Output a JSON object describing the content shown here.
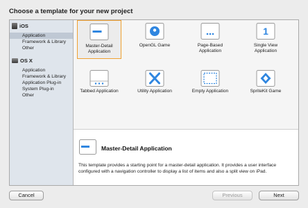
{
  "title": "Choose a template for your new project",
  "sidebar": {
    "ios_header": "iOS",
    "ios_items": [
      "Application",
      "Framework & Library",
      "Other"
    ],
    "osx_header": "OS X",
    "osx_items": [
      "Application",
      "Framework & Library",
      "Application Plug-in",
      "System Plug-in",
      "Other"
    ],
    "selected": "iOS / Application"
  },
  "templates": [
    {
      "label": "Master-Detail Application",
      "icon": "master-detail-icon",
      "selected": true
    },
    {
      "label": "OpenGL Game",
      "icon": "opengl-icon"
    },
    {
      "label": "Page-Based Application",
      "icon": "page-based-icon"
    },
    {
      "label": "Single View Application",
      "icon": "single-view-icon"
    },
    {
      "label": "Tabbed Application",
      "icon": "tabbed-icon"
    },
    {
      "label": "Utility Application",
      "icon": "utility-icon"
    },
    {
      "label": "Empty Application",
      "icon": "empty-icon"
    },
    {
      "label": "SpriteKit Game",
      "icon": "spritekit-icon"
    }
  ],
  "detail": {
    "title": "Master-Detail Application",
    "description": "This template provides a starting point for a master-detail application. It provides a user interface configured with a navigation controller to display a list of items and also a split view on iPad."
  },
  "buttons": {
    "cancel": "Cancel",
    "previous": "Previous",
    "next": "Next"
  },
  "colors": {
    "accent": "#2f86e0",
    "selection_border": "#f0a030",
    "sidebar_bg": "#dfe5ec"
  }
}
